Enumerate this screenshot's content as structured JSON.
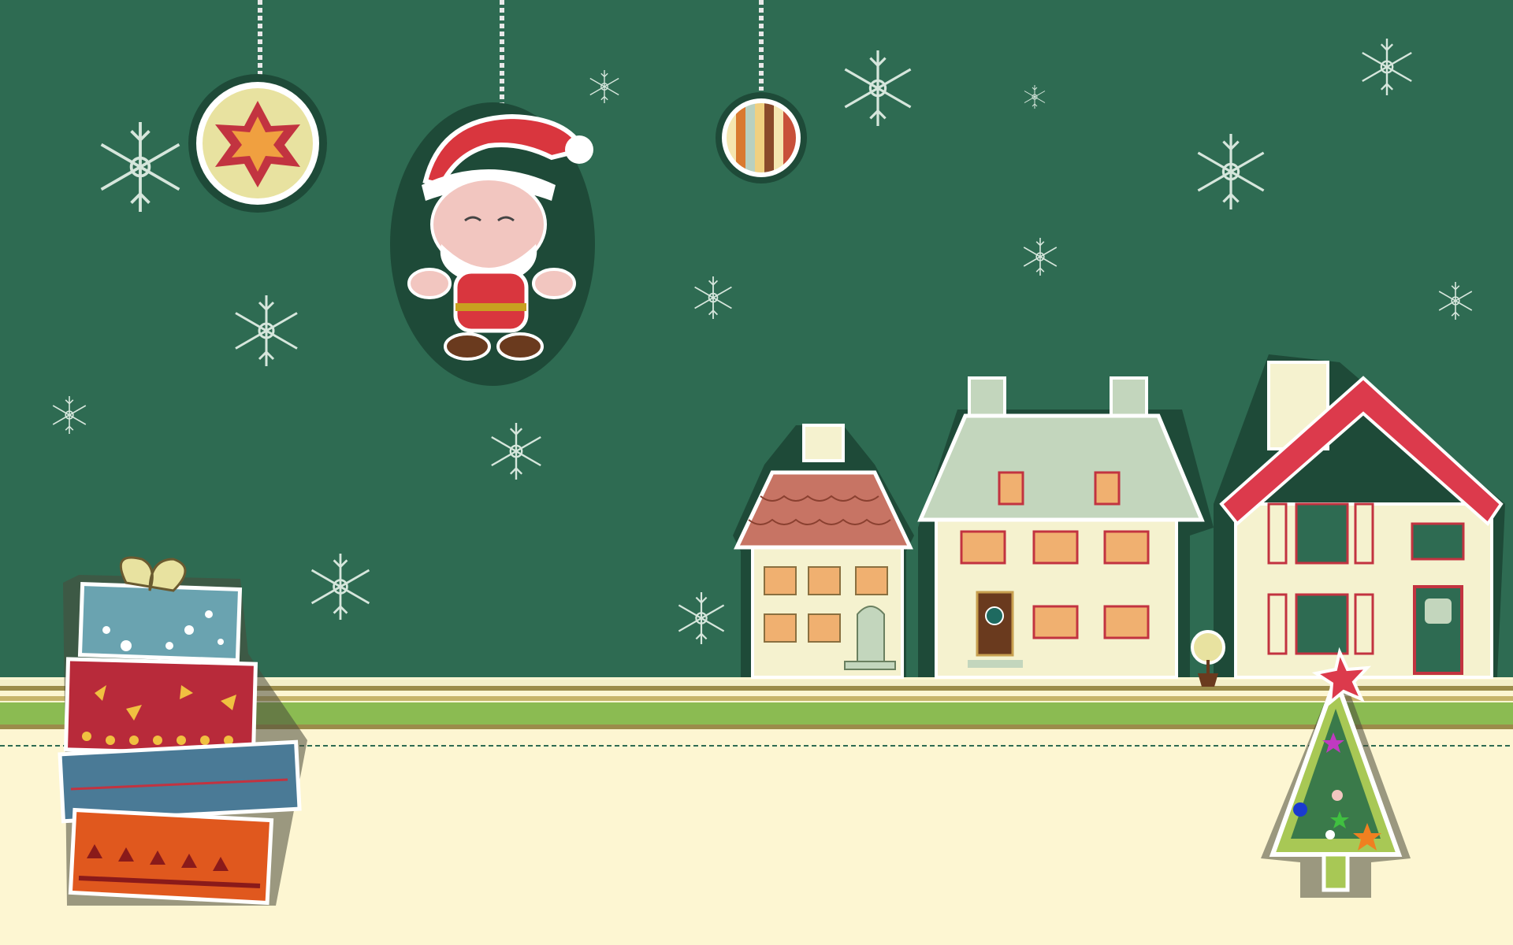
{
  "scene": {
    "title": "",
    "elements": {
      "ornaments": [
        {
          "name": "star-ornament",
          "pattern": "six-point-star"
        },
        {
          "name": "santa-ornament",
          "character": "santa-claus"
        },
        {
          "name": "striped-ornament",
          "pattern": "vertical-stripes"
        }
      ],
      "houses": [
        {
          "name": "small-brown-roof-house"
        },
        {
          "name": "large-grey-roof-house"
        },
        {
          "name": "red-roof-snow-house"
        }
      ],
      "gifts": [
        "bow-top-blue-gift",
        "red-patterned-gift",
        "blue-patterned-gift",
        "orange-patterned-gift"
      ],
      "tree": "decorated-christmas-tree"
    }
  },
  "colors": {
    "background": "#2e6b52",
    "ground": "#fdf6d2",
    "stripe_green": "#8bbb52",
    "santa_red": "#d9363e",
    "house_cream": "#f5f2cf",
    "roof_brown": "#c77464",
    "roof_grey": "#c3d6bd",
    "roof_red": "#dc3a4c",
    "snowflake": "#d6e6dc"
  }
}
